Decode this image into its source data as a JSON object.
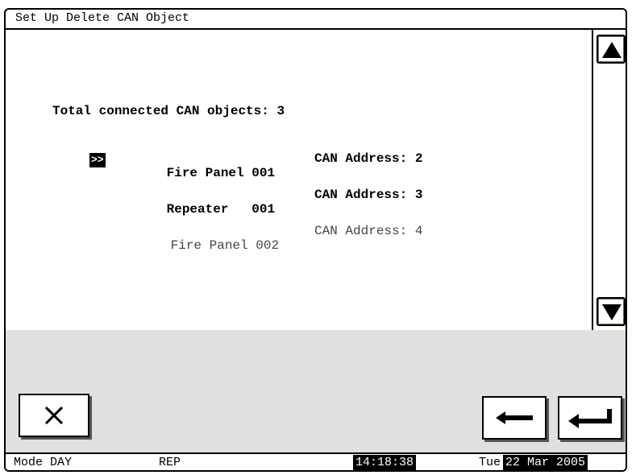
{
  "window": {
    "title": "Set Up Delete CAN Object"
  },
  "summary": {
    "total_label": "Total connected CAN objects: 3"
  },
  "objects": [
    {
      "cursor": ">>",
      "name": "Fire Panel",
      "number": "001",
      "address": "CAN Address: 2",
      "style": "selected"
    },
    {
      "name": "Repeater  ",
      "number": "001",
      "address": "CAN Address: 3",
      "style": "bold"
    },
    {
      "name": "Fire Panel",
      "number": "002",
      "address": "CAN Address: 4",
      "style": "normal"
    }
  ],
  "scroll": {
    "up_icon": "triangle-up-icon",
    "down_icon": "triangle-down-icon"
  },
  "buttons": {
    "cancel_icon": "close-icon",
    "back_icon": "arrow-left-icon",
    "enter_icon": "enter-arrow-icon"
  },
  "status": {
    "mode": "Mode DAY",
    "panel": "REP",
    "time": "14:18:38",
    "weekday": "Tue",
    "date": "22 Mar 2005"
  },
  "colors": {
    "background": "#ffffff",
    "panel_gray": "#e0e0e0",
    "highlight": "#000000"
  }
}
